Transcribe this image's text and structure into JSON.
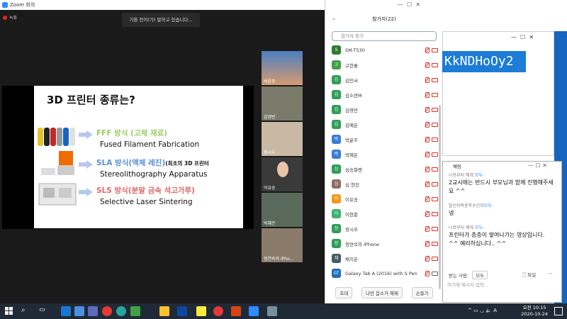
{
  "zoom": {
    "window_title": "Zoom 회의",
    "recording_label": "녹화",
    "notice": "기환 전이(가) 말하고 있습니다..."
  },
  "slide": {
    "title": "3D 프린터 종류는?",
    "rows": [
      {
        "kh": "FFF 방식 (고체 재료)",
        "en": "Fused Filament Fabrication",
        "color": "#9ccc65",
        "extra": ""
      },
      {
        "kh": "SLA 방식(액체 레진)",
        "en": "Stereolithography Apparatus",
        "color": "#5b8fd6",
        "extra": "(최초의 3D 프린터"
      },
      {
        "kh": "SLS 방식(분말 금속 석고가루)",
        "en": "Selective Laser Sintering",
        "color": "#e06666",
        "extra": ""
      }
    ]
  },
  "gallery": [
    {
      "name": "박윤주"
    },
    {
      "name": "김영빈"
    },
    {
      "name": "정시우"
    },
    {
      "name": "이유송"
    },
    {
      "name": "박혜은"
    },
    {
      "name": "정연숙의 iPho..."
    }
  ],
  "participants": {
    "title": "참가자(22)",
    "search_placeholder": "참가자 찾기",
    "list": [
      {
        "initial": "S",
        "name": "SM-T530",
        "color": "#2e7d32",
        "cam_off": true
      },
      {
        "initial": "고",
        "name": "고한솔",
        "color": "#43a047",
        "cam_off": true
      },
      {
        "initial": "김",
        "name": "김민서",
        "color": "#2e9e58",
        "cam_off": true
      },
      {
        "initial": "김",
        "name": "김소연M",
        "color": "#2e9e58",
        "cam_off": true
      },
      {
        "initial": "김",
        "name": "김영빈",
        "color": "#2e9e58",
        "cam_off": true
      },
      {
        "initial": "김",
        "name": "김예은",
        "color": "#2e9e58",
        "cam_off": true
      },
      {
        "initial": "박",
        "name": "박윤주",
        "color": "#3c7bd9",
        "cam_off": true
      },
      {
        "initial": "박",
        "name": "박혜은",
        "color": "#3c7bd9",
        "cam_off": true
      },
      {
        "initial": "심",
        "name": "심승화맨",
        "color": "#2e9e58",
        "cam_off": true
      },
      {
        "initial": "심",
        "name": "심 현진",
        "color": "#8d6e63",
        "cam_off": true
      },
      {
        "initial": "이",
        "name": "이유송",
        "color": "#f29a1d",
        "cam_off": true
      },
      {
        "initial": "이",
        "name": "이현준",
        "color": "#3cb371",
        "cam_off": true
      },
      {
        "initial": "정",
        "name": "정시우",
        "color": "#2e9e58",
        "cam_off": true
      },
      {
        "initial": "정",
        "name": "정연숙의 iPhone",
        "color": "#2e9e58",
        "cam_off": true
      },
      {
        "initial": "채",
        "name": "채지은",
        "color": "#455a64",
        "cam_off": true
      },
      {
        "initial": "GT",
        "name": "Galaxy Tab A (2016) with S Pen",
        "color": "#1e6fb8",
        "cam_off": false
      }
    ],
    "buttons": [
      "초대",
      "나만 음소거 해제",
      "손들기"
    ]
  },
  "bgwindow": {
    "code": "KkNDHoOy2"
  },
  "chat": {
    "title": "채팅",
    "messages": [
      {
        "from": "나로부터 에게",
        "to": "모두:",
        "text": "2교시에는 반드시 부모님과 함께 진행해주세요 ^^"
      },
      {
        "from": "발신자박윤주수신자",
        "to": "모두:",
        "text": "넹"
      },
      {
        "from": "나로부터 에게",
        "to": "모두:",
        "text": "프린터가 층층이 쌓여나가는 영상입니다. ^^ 예리하십니다.. ^^"
      }
    ],
    "to_label": "받는 사람:",
    "to_value": "모두",
    "file_label": "파일",
    "input_placeholder": "여기에 메시지 입력..."
  },
  "taskbar": {
    "time": "오전 10:15",
    "date": "2020-10-24"
  }
}
